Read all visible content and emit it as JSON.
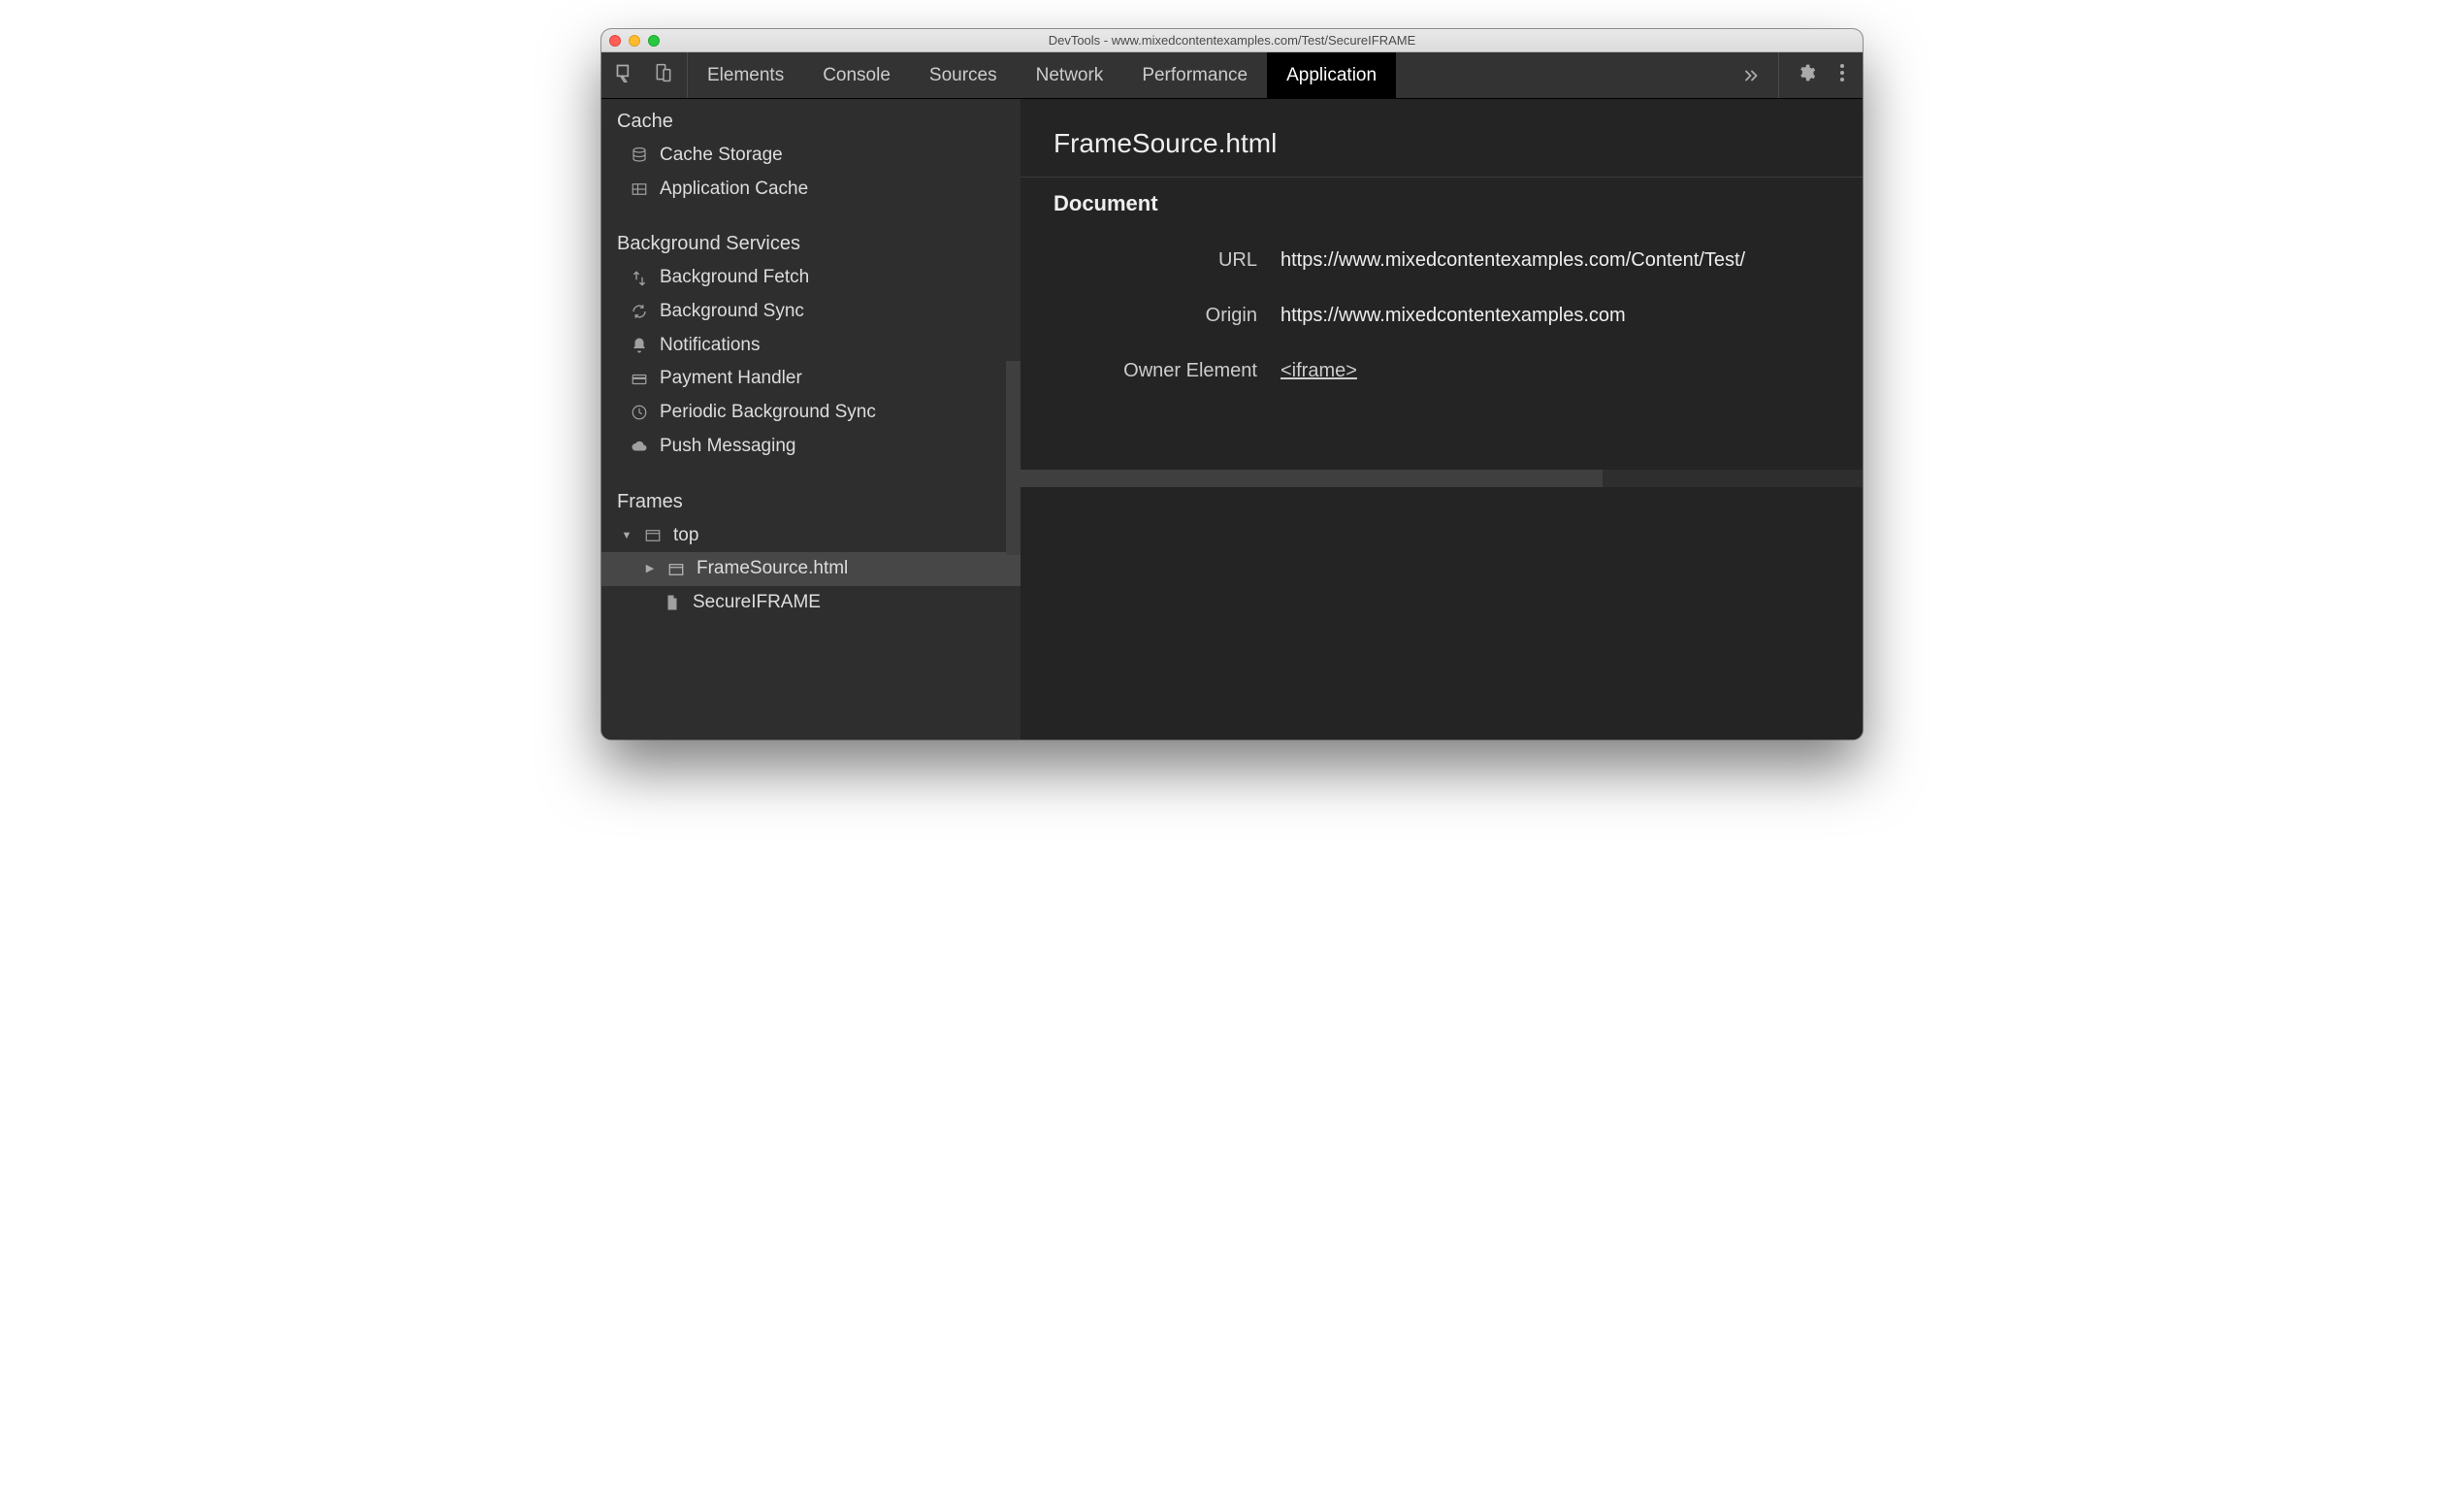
{
  "window_title": "DevTools - www.mixedcontentexamples.com/Test/SecureIFRAME",
  "tabs": {
    "elements": "Elements",
    "console": "Console",
    "sources": "Sources",
    "network": "Network",
    "performance": "Performance",
    "application": "Application"
  },
  "sidebar": {
    "cache": {
      "header": "Cache",
      "cache_storage": "Cache Storage",
      "application_cache": "Application Cache"
    },
    "bg": {
      "header": "Background Services",
      "background_fetch": "Background Fetch",
      "background_sync": "Background Sync",
      "notifications": "Notifications",
      "payment_handler": "Payment Handler",
      "periodic_bg_sync": "Periodic Background Sync",
      "push_messaging": "Push Messaging"
    },
    "frames": {
      "header": "Frames",
      "top": "top",
      "frame_source": "FrameSource.html",
      "secure_iframe": "SecureIFRAME"
    }
  },
  "main": {
    "title": "FrameSource.html",
    "section": "Document",
    "url_label": "URL",
    "url_value": "https://www.mixedcontentexamples.com/Content/Test/",
    "origin_label": "Origin",
    "origin_value": "https://www.mixedcontentexamples.com",
    "owner_label": "Owner Element",
    "owner_value": "<iframe>"
  }
}
